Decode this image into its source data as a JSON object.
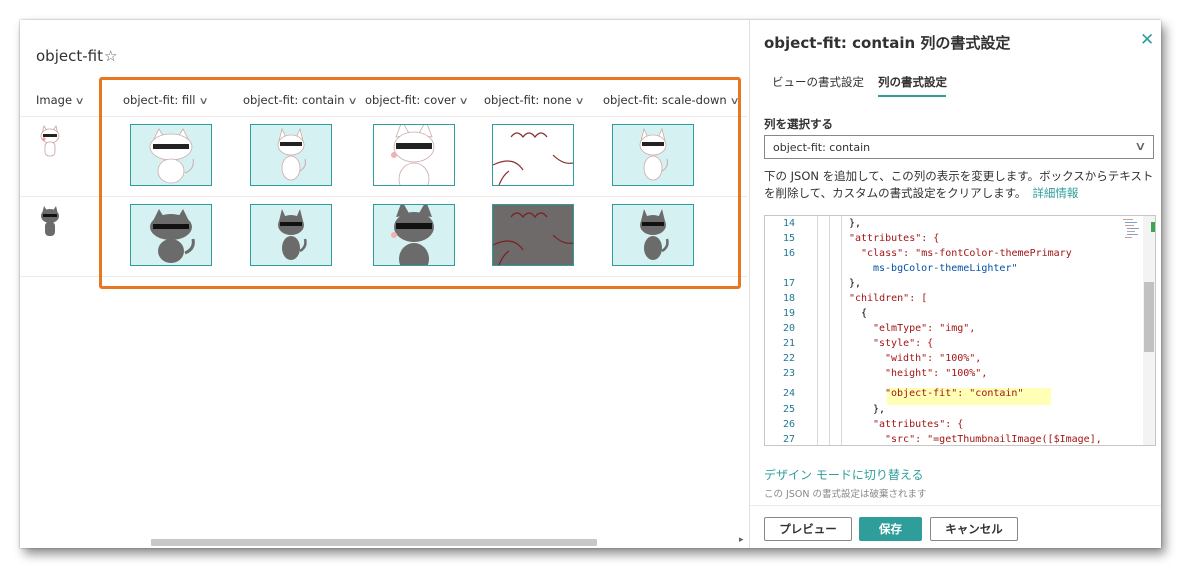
{
  "list": {
    "title": "object-fit",
    "favorite_icon": "star-outline-icon",
    "columns": [
      {
        "label": "Image"
      },
      {
        "label": "object-fit: fill"
      },
      {
        "label": "object-fit: contain"
      },
      {
        "label": "object-fit: cover"
      },
      {
        "label": "object-fit: none"
      },
      {
        "label": "object-fit: scale-down"
      }
    ],
    "rows": [
      {
        "cat": "white-cat"
      },
      {
        "cat": "gray-cat"
      }
    ],
    "accent_color": "#2f9e9b",
    "highlight_color": "#e87722"
  },
  "pane": {
    "title": "object-fit: contain 列の書式設定",
    "tabs": [
      {
        "label": "ビューの書式設定"
      },
      {
        "label": "列の書式設定"
      }
    ],
    "select_label": "列を選択する",
    "select_value": "object-fit: contain",
    "description": "下の JSON を追加して、この列の表示を変更します。ボックスからテキストを削除して、カスタムの書式設定をクリアします。",
    "more_info": "詳細情報",
    "code_lines": [
      {
        "n": "14",
        "text": "},"
      },
      {
        "n": "15",
        "text": "\"attributes\": {"
      },
      {
        "n": "16",
        "text": "\"class\": \"ms-fontColor-themePrimary"
      },
      {
        "n": "",
        "text": "ms-bgColor-themeLighter\""
      },
      {
        "n": "17",
        "text": "},"
      },
      {
        "n": "18",
        "text": "\"children\": ["
      },
      {
        "n": "19",
        "text": "{"
      },
      {
        "n": "20",
        "text": "\"elmType\": \"img\","
      },
      {
        "n": "21",
        "text": "\"style\": {"
      },
      {
        "n": "22",
        "text": "\"width\": \"100%\","
      },
      {
        "n": "23",
        "text": "\"height\": \"100%\","
      },
      {
        "n": "24",
        "text": "\"object-fit\": \"contain\""
      },
      {
        "n": "25",
        "text": "},"
      },
      {
        "n": "26",
        "text": "\"attributes\": {"
      },
      {
        "n": "27",
        "text": "\"src\": \"=getThumbnailImage([$Image],"
      }
    ],
    "design_mode_link": "デザイン モードに切り替える",
    "design_mode_note": "この JSON の書式設定は破棄されます",
    "buttons": {
      "preview": "プレビュー",
      "save": "保存",
      "cancel": "キャンセル"
    }
  }
}
